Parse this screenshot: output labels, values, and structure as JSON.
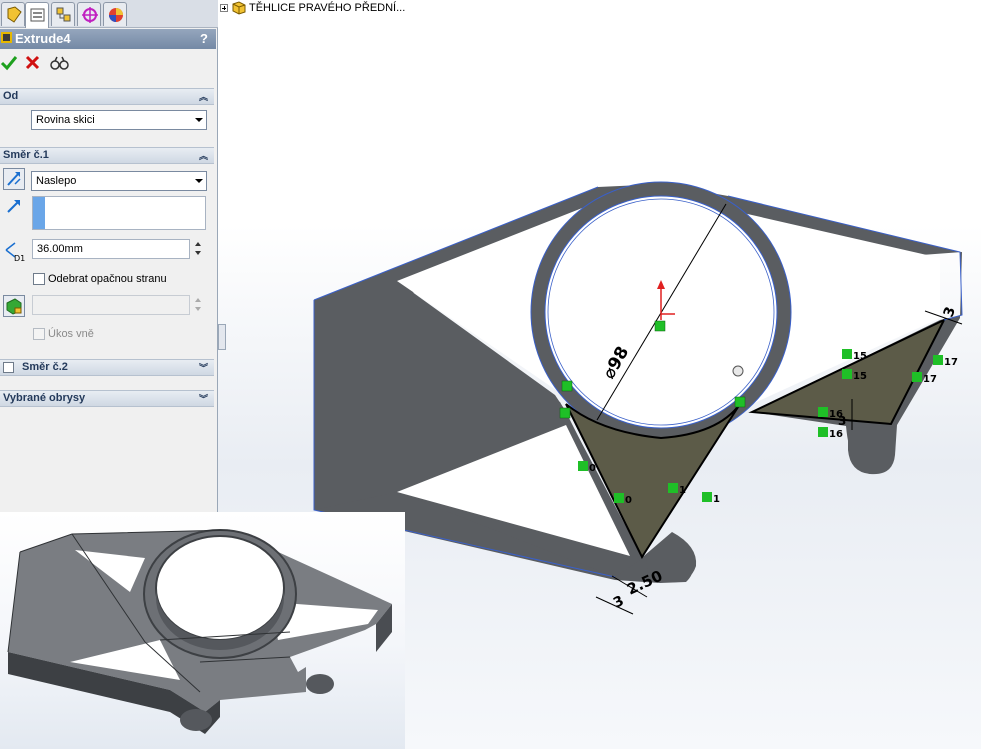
{
  "feature_tree": {
    "root_item": "TĚHLICE PRAVÉHO PŘEDNÍ..."
  },
  "property_manager": {
    "tabs": [
      "feature-manager-icon",
      "property-manager-icon",
      "configuration-manager-icon",
      "dimxpert-icon",
      "display-manager-icon"
    ],
    "title": "Extrude4",
    "help": "?",
    "actions": [
      "ok-icon",
      "cancel-icon",
      "preview-icon"
    ],
    "from_group": {
      "header": "Od",
      "start_condition": "Rovina skici"
    },
    "direction1_group": {
      "header": "Směr č.1",
      "end_condition": "Naslepo",
      "depth_label": "D1",
      "depth_value": "36.00mm",
      "flip_side_label": "Odebrat opačnou stranu",
      "flip_side_checked": false,
      "draft_outward_label": "Úkos vně",
      "draft_outward_enabled": false
    },
    "direction2_group": {
      "header": "Směr č.2",
      "enabled": false
    },
    "selected_contours_group": {
      "header": "Vybrané obrysy"
    }
  },
  "sketch": {
    "diameter_dimension": "⌀98",
    "dimension_fillet": "2.50",
    "dimension_small_left": "3",
    "dimension_small_right": "3",
    "dimension_small_mid": "3",
    "relations": {
      "r0a": "0",
      "r0b": "0",
      "r1a": "1",
      "r1b": "1",
      "r15a": "15",
      "r15b": "15",
      "r16a": "16",
      "r16b": "16",
      "r17a": "17",
      "r17b": "17"
    }
  },
  "colors": {
    "part_gray": "#5a5d61",
    "sketch_blue": "#3a60c9",
    "region_fill": "#5c5b48",
    "relation_green": "#1fbf27",
    "origin_red": "#e02020",
    "panel_title": "#7e91ab"
  }
}
